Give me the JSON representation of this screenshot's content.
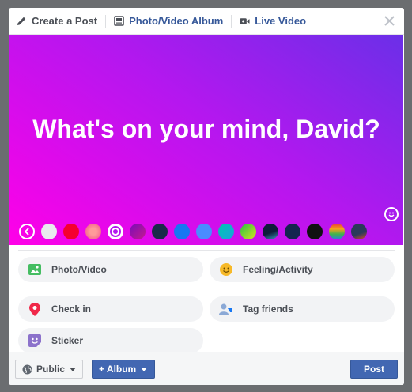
{
  "tabs": {
    "create_post": "Create a Post",
    "photo_album": "Photo/Video Album",
    "live_video": "Live Video"
  },
  "composer": {
    "prompt": "What's on your mind, David?",
    "selected_background": "purple-magenta-gradient"
  },
  "options": {
    "photo_video": "Photo/Video",
    "feeling": "Feeling/Activity",
    "check_in": "Check in",
    "tag_friends": "Tag friends",
    "sticker": "Sticker"
  },
  "footer": {
    "audience": "Public",
    "album": "+ Album",
    "post": "Post"
  },
  "colors": {
    "accent": "#4267b2",
    "link": "#365899",
    "gradient_start": "#ff00e8",
    "gradient_end": "#6b2fe8"
  }
}
